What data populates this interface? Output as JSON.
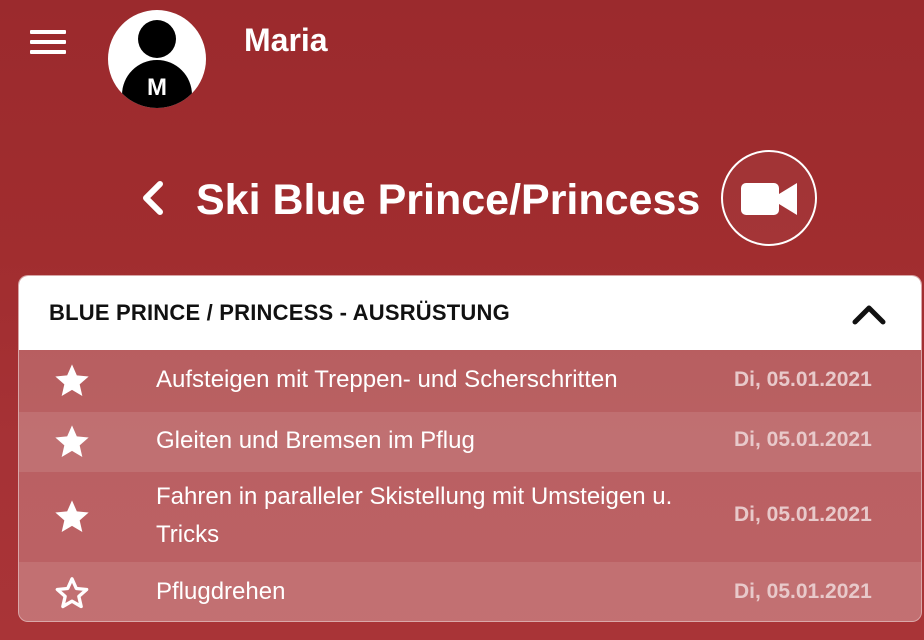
{
  "header": {
    "menu_icon": "hamburger-menu-icon",
    "avatar_initial": "M",
    "username": "Maria"
  },
  "page": {
    "title": "Ski Blue Prince/Princess",
    "back_icon": "chevron-left-icon",
    "video_icon": "video-camera-icon"
  },
  "section": {
    "title": "BLUE PRINCE / PRINCESS - AUSRÜSTUNG",
    "expanded": true,
    "collapse_icon": "chevron-up-icon",
    "items": [
      {
        "label": "Aufsteigen mit Treppen- und Scherschritten",
        "date": "Di, 05.01.2021",
        "completed": true
      },
      {
        "label": "Gleiten und Bremsen im Pflug",
        "date": "Di, 05.01.2021",
        "completed": true
      },
      {
        "label": "Fahren in paralleler Skistellung mit Umsteigen u. Tricks",
        "date": "Di, 05.01.2021",
        "completed": true
      },
      {
        "label": "Pflugdrehen",
        "date": "Di, 05.01.2021",
        "completed": false
      }
    ]
  },
  "colors": {
    "background": "#a12d2f",
    "header_bg": "#ffffff",
    "date_text": "#e8c9ca"
  }
}
